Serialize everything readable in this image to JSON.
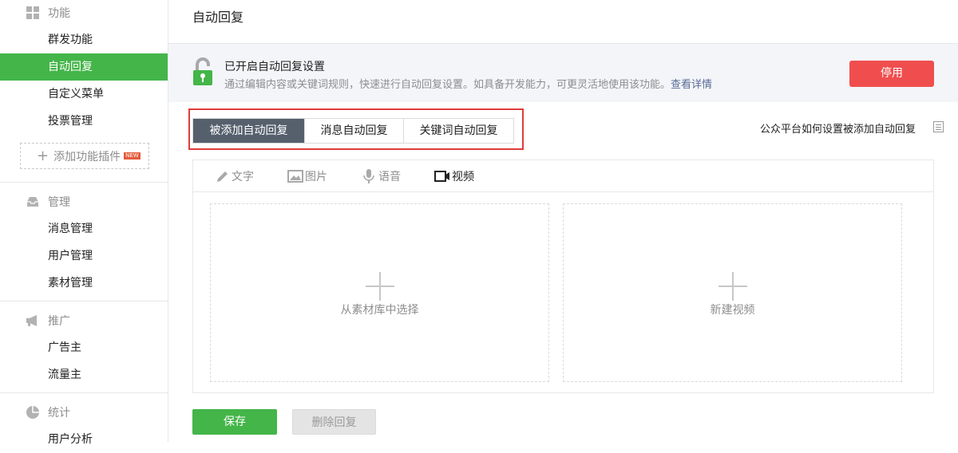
{
  "sidebar": {
    "sections": [
      {
        "title": "功能",
        "icon": "grid-icon",
        "items": [
          {
            "label": "群发功能",
            "active": false
          },
          {
            "label": "自动回复",
            "active": true
          },
          {
            "label": "自定义菜单",
            "active": false
          },
          {
            "label": "投票管理",
            "active": false
          }
        ]
      },
      {
        "title": "管理",
        "icon": "inbox-icon",
        "items": [
          {
            "label": "消息管理"
          },
          {
            "label": "用户管理"
          },
          {
            "label": "素材管理"
          }
        ]
      },
      {
        "title": "推广",
        "icon": "megaphone-icon",
        "items": [
          {
            "label": "广告主"
          },
          {
            "label": "流量主"
          }
        ]
      },
      {
        "title": "统计",
        "icon": "pie-chart-icon",
        "items": [
          {
            "label": "用户分析"
          }
        ]
      }
    ],
    "add_plugin_label": "添加功能插件",
    "new_badge": "NEW"
  },
  "page": {
    "title": "自动回复"
  },
  "info": {
    "title": "已开启自动回复设置",
    "description": "通过编辑内容或关键词规则，快速进行自动回复设置。如具备开发能力，可更灵活地使用该功能。",
    "details_link": "查看详情",
    "stop_button": "停用"
  },
  "tabs": [
    {
      "label": "被添加自动回复",
      "active": true
    },
    {
      "label": "消息自动回复",
      "active": false
    },
    {
      "label": "关键词自动回复",
      "active": false
    }
  ],
  "help_link": "公众平台如何设置被添加自动回复",
  "editor": {
    "tools": [
      {
        "label": "文字",
        "icon": "pencil-icon",
        "selected": false
      },
      {
        "label": "图片",
        "icon": "image-icon",
        "selected": false
      },
      {
        "label": "语音",
        "icon": "microphone-icon",
        "selected": false
      },
      {
        "label": "视频",
        "icon": "video-icon",
        "selected": true
      }
    ],
    "panels": [
      {
        "label": "从素材库中选择"
      },
      {
        "label": "新建视频"
      }
    ]
  },
  "actions": {
    "save": "保存",
    "delete": "删除回复"
  },
  "colors": {
    "accent_green": "#44b549",
    "danger_red": "#f04e4e",
    "active_tab": "#56606d",
    "highlight_box": "#e03b3b",
    "link_blue": "#576b95"
  }
}
